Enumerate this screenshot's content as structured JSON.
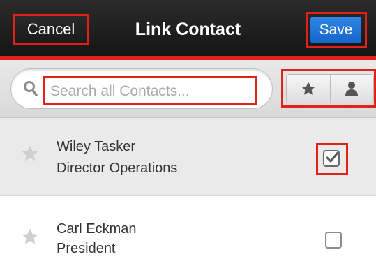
{
  "header": {
    "cancel_label": "Cancel",
    "title": "Link Contact",
    "save_label": "Save"
  },
  "search": {
    "placeholder": "Search all Contacts..."
  },
  "filters": [
    {
      "name": "favorites",
      "icon": "star-icon"
    },
    {
      "name": "my-items",
      "icon": "person-icon"
    }
  ],
  "contacts": [
    {
      "name": "Wiley Tasker",
      "title": "Director Operations",
      "selected": true
    },
    {
      "name": "Carl Eckman",
      "title": "President",
      "selected": false
    }
  ],
  "colors": {
    "highlight": "#e0221b",
    "save_button": "#1664c8",
    "header": "#1a1a1a"
  }
}
